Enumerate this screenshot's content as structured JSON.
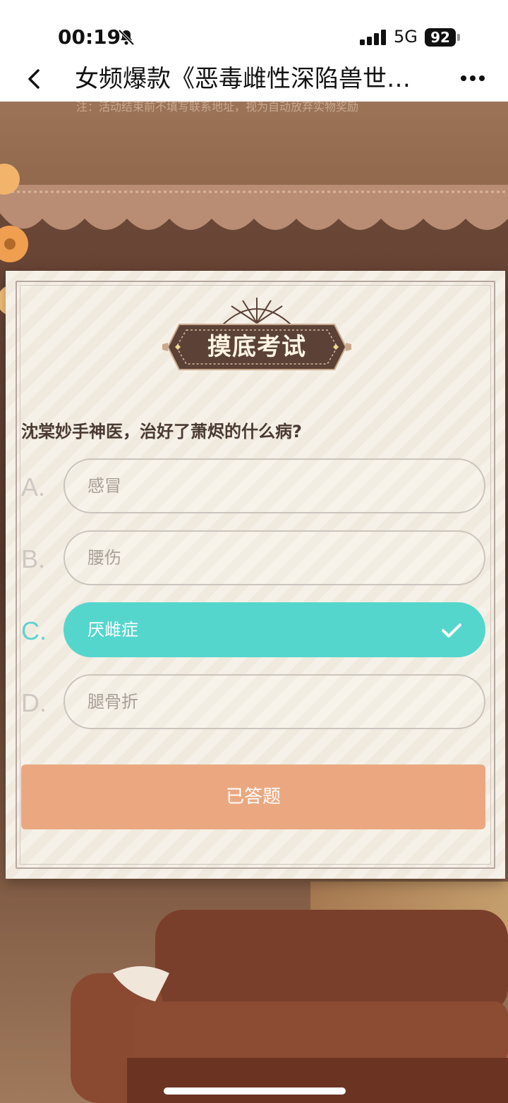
{
  "status_bar": {
    "time": "00:19",
    "network": "5G",
    "battery": "92"
  },
  "nav": {
    "title": "女频爆款《恶毒雌性深陷兽世…"
  },
  "background": {
    "note": "注：活动结束前不填写联系地址，视为自动放弃实物奖励"
  },
  "quiz": {
    "badge_title": "摸底考试",
    "question": "沈棠妙手神医，治好了萧烬的什么病?",
    "options": [
      {
        "letter": "A.",
        "label": "感冒",
        "selected": false
      },
      {
        "letter": "B.",
        "label": "腰伤",
        "selected": false
      },
      {
        "letter": "C.",
        "label": "厌雌症",
        "selected": true
      },
      {
        "letter": "D.",
        "label": "腿骨折",
        "selected": false
      }
    ],
    "submit_label": "已答题"
  },
  "colors": {
    "selected": "#55d6cd",
    "submit": "#eba880",
    "badge": "#5b4136"
  }
}
